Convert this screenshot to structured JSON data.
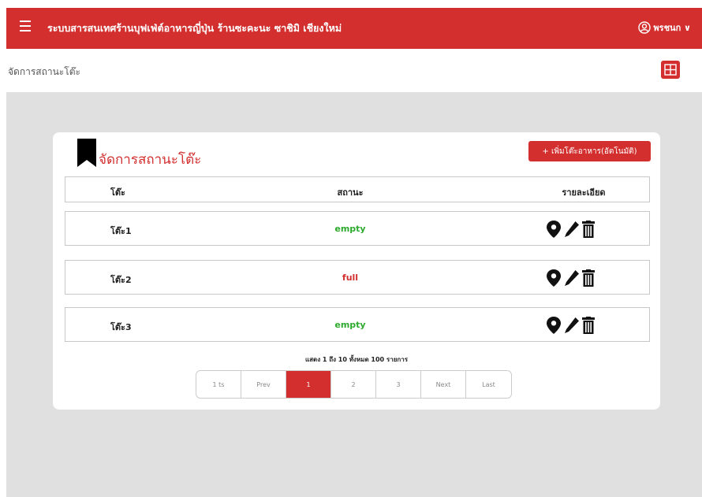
{
  "app": {
    "title": "ระบบสารสนเทศร้านบุฟเฟ่ต์อาหารญี่ปุ่น ร้านซะคะนะ ซาชิมิ เชียงใหม่",
    "user": "พรชนก ∨"
  },
  "breadcrumb": "จัดการสถานะโต๊ะ",
  "card": {
    "title": "จัดการสถานะโต๊ะ",
    "add_button": "+ เพิ่มโต๊ะอาหาร(อัตโนมัติ)"
  },
  "table": {
    "headers": {
      "name": "โต๊ะ",
      "status": "สถานะ",
      "detail": "รายละเอียด"
    },
    "rows": [
      {
        "name": "โต๊ะ1",
        "status": "empty"
      },
      {
        "name": "โต๊ะ2",
        "status": "full"
      },
      {
        "name": "โต๊ะ3",
        "status": "empty"
      }
    ]
  },
  "summary": "แสดง 1 ถึง 10 ทั้งหมด 100 รายการ",
  "pagination": {
    "first": "1 ts",
    "prev": "Prev",
    "pages": [
      "1",
      "2",
      "3"
    ],
    "active_page": "1",
    "next": "Next",
    "last": "Last"
  },
  "colors": {
    "brand": "#d32f2f",
    "status_empty": "#2eaa2e",
    "status_full": "#d32f2f",
    "background": "#e0e0e0"
  },
  "icons": [
    "menu-icon",
    "user-circle-icon",
    "grid-view-icon",
    "bookmark-icon",
    "location-pin-icon",
    "edit-icon",
    "trash-icon"
  ]
}
